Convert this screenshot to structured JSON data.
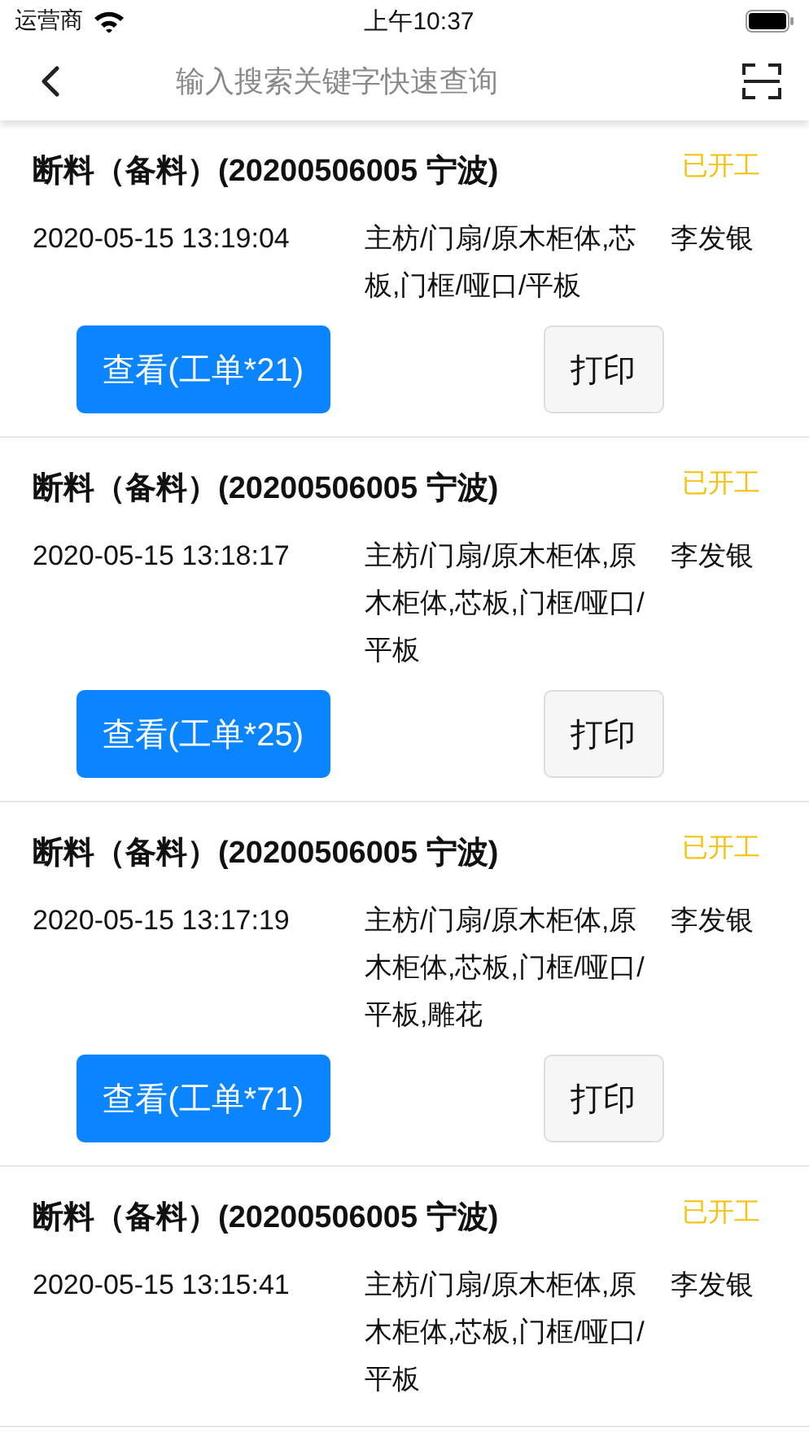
{
  "status_bar": {
    "carrier": "运营商",
    "time": "上午10:37"
  },
  "search": {
    "placeholder": "输入搜索关键字快速查询"
  },
  "orders": [
    {
      "title": "断料（备料）(20200506005 宁波)",
      "status": "已开工",
      "time": "2020-05-15 13:19:04",
      "parts": "主枋/门扇/原木柜体,芯板,门框/哑口/平板",
      "person": "李发银",
      "buttons": [
        {
          "kind": "primary",
          "label": "查看(工单*21)"
        },
        {
          "kind": "secondary",
          "label": "打印"
        }
      ]
    },
    {
      "title": "断料（备料）(20200506005 宁波)",
      "status": "已开工",
      "time": "2020-05-15 13:18:17",
      "parts": "主枋/门扇/原木柜体,原木柜体,芯板,门框/哑口/平板",
      "person": "李发银",
      "buttons": [
        {
          "kind": "primary",
          "label": "查看(工单*25)"
        },
        {
          "kind": "secondary",
          "label": "打印"
        }
      ]
    },
    {
      "title": "断料（备料）(20200506005 宁波)",
      "status": "已开工",
      "time": "2020-05-15 13:17:19",
      "parts": "主枋/门扇/原木柜体,原木柜体,芯板,门框/哑口/平板,雕花",
      "person": "李发银",
      "buttons": [
        {
          "kind": "primary",
          "label": "查看(工单*71)"
        },
        {
          "kind": "secondary",
          "label": "打印"
        }
      ]
    },
    {
      "title": "断料（备料）(20200506005 宁波)",
      "status": "已开工",
      "time": "2020-05-15 13:15:41",
      "parts": "主枋/门扇/原木柜体,原木柜体,芯板,门框/哑口/平板",
      "person": "李发银"
    }
  ]
}
